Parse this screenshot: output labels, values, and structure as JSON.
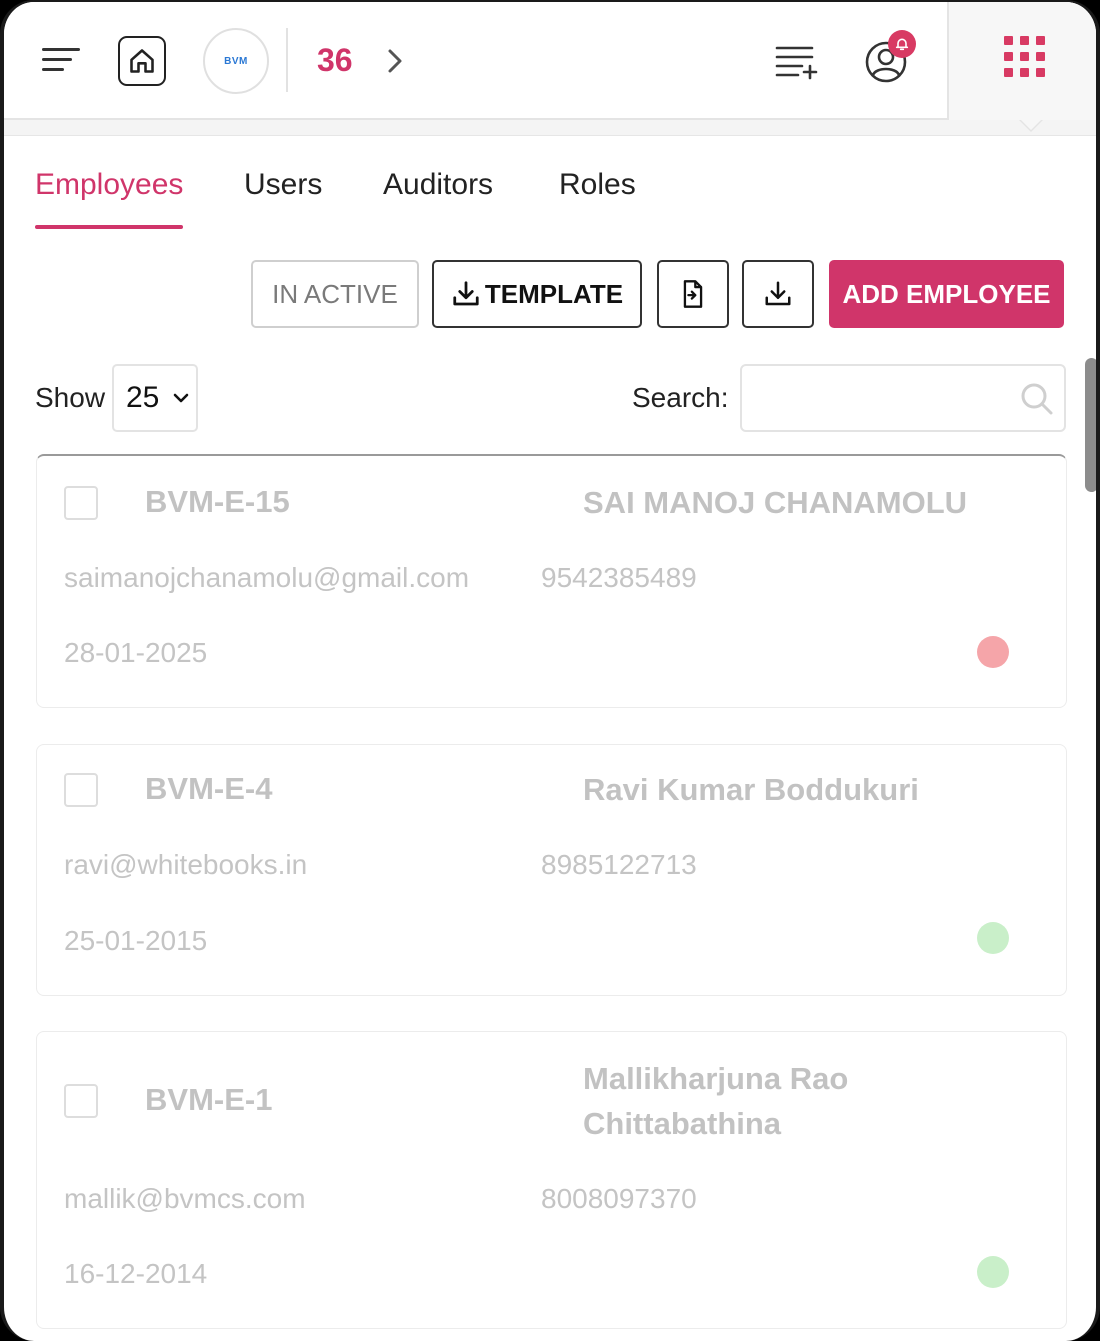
{
  "header": {
    "logo_text": "BVM",
    "count": "36",
    "accent_color": "#d0356a",
    "icons": [
      "menu-icon",
      "home-icon",
      "chevron-right-icon",
      "list-add-icon",
      "user-settings-icon",
      "bell-icon",
      "apps-grid-icon"
    ]
  },
  "tabs": [
    {
      "label": "Employees",
      "active": true
    },
    {
      "label": "Users",
      "active": false
    },
    {
      "label": "Auditors",
      "active": false
    },
    {
      "label": "Roles",
      "active": false
    }
  ],
  "actions": {
    "inactive_label": "IN ACTIVE",
    "template_label": "TEMPLATE",
    "add_label": "ADD EMPLOYEE"
  },
  "table_controls": {
    "show_label": "Show",
    "page_size": "25",
    "search_label": "Search:",
    "search_value": ""
  },
  "employees": [
    {
      "code": "BVM-E-15",
      "name": "SAI MANOJ CHANAMOLU",
      "email": "saimanojchanamolu@gmail.com",
      "phone": "9542385489",
      "date": "28-01-2025",
      "status_color": "#f5a5a9"
    },
    {
      "code": "BVM-E-4",
      "name": "Ravi Kumar Boddukuri",
      "email": "ravi@whitebooks.in",
      "phone": "8985122713",
      "date": "25-01-2015",
      "status_color": "#c9efc9"
    },
    {
      "code": "BVM-E-1",
      "name": "Mallikharjuna Rao Chittabathina",
      "email": "mallik@bvmcs.com",
      "phone": "8008097370",
      "date": "16-12-2014",
      "status_color": "#c9efc9"
    }
  ]
}
